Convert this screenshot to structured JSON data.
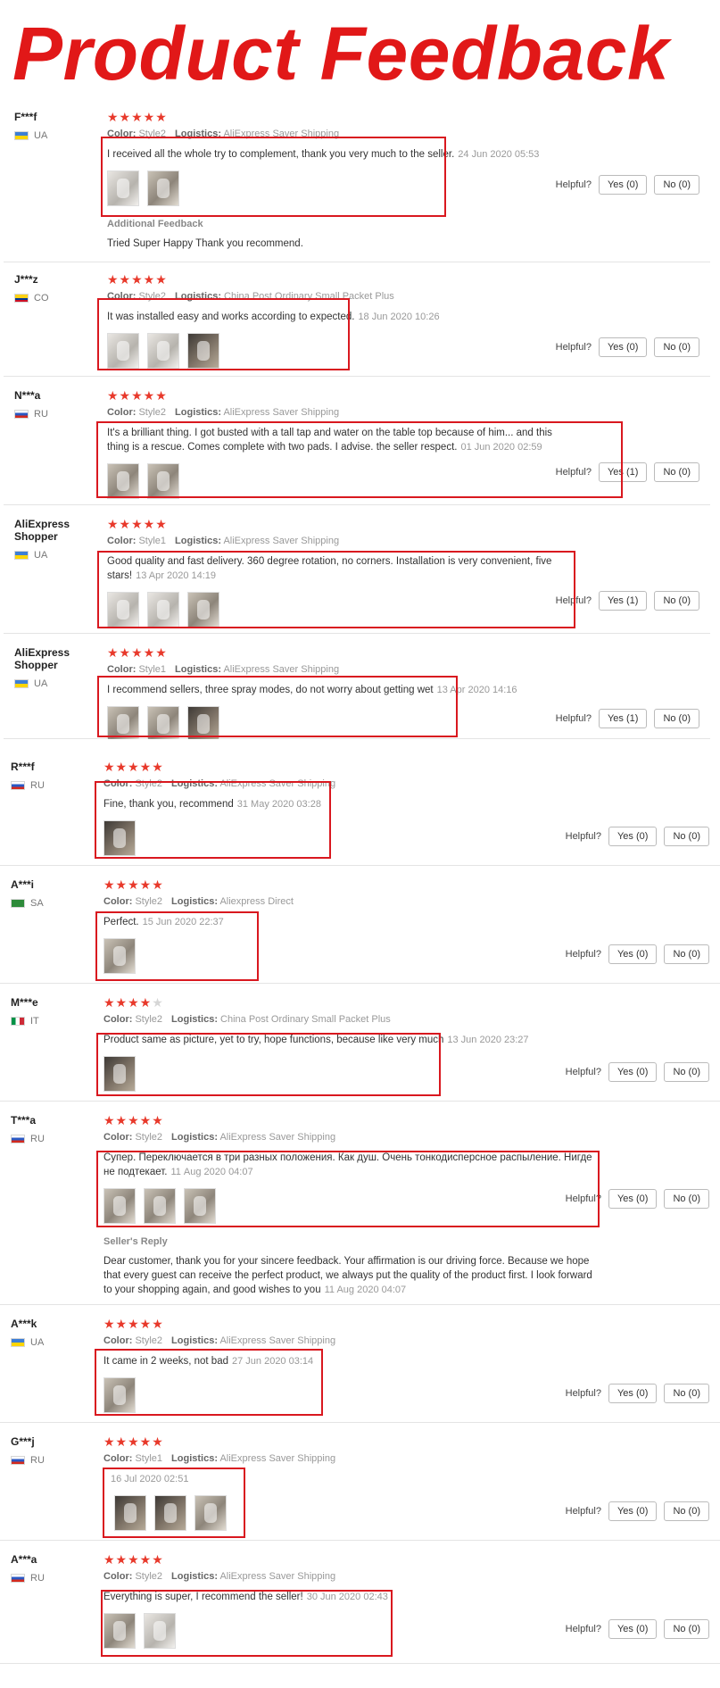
{
  "title": "Product Feedback",
  "labels": {
    "color": "Color:",
    "logistics": "Logistics:",
    "helpful": "Helpful?",
    "star_full": "★★★★★",
    "star_four": "★★★★",
    "star_empty": "★"
  },
  "reviews": [
    {
      "user": "F***f",
      "country": "UA",
      "rating": 5,
      "color": "Style2",
      "logistics": "AliExpress Saver Shipping",
      "text": "I received all the whole try to complement, thank you very much to the seller.",
      "date": "24 Jun 2020 05:53",
      "yes": "Yes (0)",
      "no": "No (0)",
      "additional_title": "Additional Feedback",
      "additional_text": "Tried Super Happy Thank you recommend."
    },
    {
      "user": "J***z",
      "country": "CO",
      "rating": 5,
      "color": "Style2",
      "logistics": "China Post Ordinary Small Packet Plus",
      "text": "It was installed easy and works according to expected.",
      "date": "18 Jun 2020 10:26",
      "yes": "Yes (0)",
      "no": "No (0)"
    },
    {
      "user": "N***a",
      "country": "RU",
      "rating": 5,
      "color": "Style2",
      "logistics": "AliExpress Saver Shipping",
      "text": "It's a brilliant thing. I got busted with a tall tap and water on the table top because of him... and this thing is a rescue. Comes complete with two pads. I advise. the seller respect.",
      "date": "01 Jun 2020 02:59",
      "yes": "Yes (1)",
      "no": "No (0)"
    },
    {
      "user": "AliExpress Shopper",
      "country": "UA",
      "rating": 5,
      "color": "Style1",
      "logistics": "AliExpress Saver Shipping",
      "text": "Good quality and fast delivery. 360 degree rotation, no corners. Installation is very convenient, five stars!",
      "date": "13 Apr 2020 14:19",
      "yes": "Yes (1)",
      "no": "No (0)"
    },
    {
      "user": "AliExpress Shopper",
      "country": "UA",
      "rating": 5,
      "color": "Style1",
      "logistics": "AliExpress Saver Shipping",
      "text": "I recommend sellers, three spray modes, do not worry about getting wet",
      "date": "13 Apr 2020 14:16",
      "yes": "Yes (1)",
      "no": "No (0)"
    },
    {
      "user": "R***f",
      "country": "RU",
      "rating": 5,
      "color": "Style2",
      "logistics": "AliExpress Saver Shipping",
      "text": "Fine, thank you, recommend",
      "date": "31 May 2020 03:28",
      "yes": "Yes (0)",
      "no": "No (0)"
    },
    {
      "user": "A***i",
      "country": "SA",
      "rating": 5,
      "color": "Style2",
      "logistics": "Aliexpress Direct",
      "text": "Perfect.",
      "date": "15 Jun 2020 22:37",
      "yes": "Yes (0)",
      "no": "No (0)"
    },
    {
      "user": "M***e",
      "country": "IT",
      "rating": 4,
      "color": "Style2",
      "logistics": "China Post Ordinary Small Packet Plus",
      "text": "Product same as picture, yet to try, hope functions, because like very much",
      "date": "13 Jun 2020 23:27",
      "yes": "Yes (0)",
      "no": "No (0)"
    },
    {
      "user": "T***a",
      "country": "RU",
      "rating": 5,
      "color": "Style2",
      "logistics": "AliExpress Saver Shipping",
      "text": "Супер. Переключается в три разных положения. Как душ. Очень тонкодисперсное распыление. Нигде не подтекает.",
      "date": "11 Aug 2020 04:07",
      "yes": "Yes (0)",
      "no": "No (0)",
      "additional_title": "Seller's Reply",
      "additional_text": "Dear customer, thank you for your sincere feedback. Your affirmation is our driving force. Because we hope that every guest can receive the perfect product, we always put the quality of the product first. I look forward to your shopping again, and good wishes to you",
      "additional_date": "11 Aug 2020 04:07"
    },
    {
      "user": "A***k",
      "country": "UA",
      "rating": 5,
      "color": "Style2",
      "logistics": "AliExpress Saver Shipping",
      "text": "It came in 2 weeks, not bad",
      "date": "27 Jun 2020 03:14",
      "yes": "Yes (0)",
      "no": "No (0)"
    },
    {
      "user": "G***j",
      "country": "RU",
      "rating": 5,
      "color": "Style1",
      "logistics": "AliExpress Saver Shipping",
      "text": "",
      "date": "16 Jul 2020 02:51",
      "yes": "Yes (0)",
      "no": "No (0)"
    },
    {
      "user": "A***a",
      "country": "RU",
      "rating": 5,
      "color": "Style2",
      "logistics": "AliExpress Saver Shipping",
      "text": "Everything is super, I recommend the seller!",
      "date": "30 Jun 2020 02:43",
      "yes": "Yes (0)",
      "no": "No (0)"
    }
  ],
  "colors": {
    "title": "#e11818",
    "stars": "#e8392b",
    "highlight": "#d9181f"
  }
}
